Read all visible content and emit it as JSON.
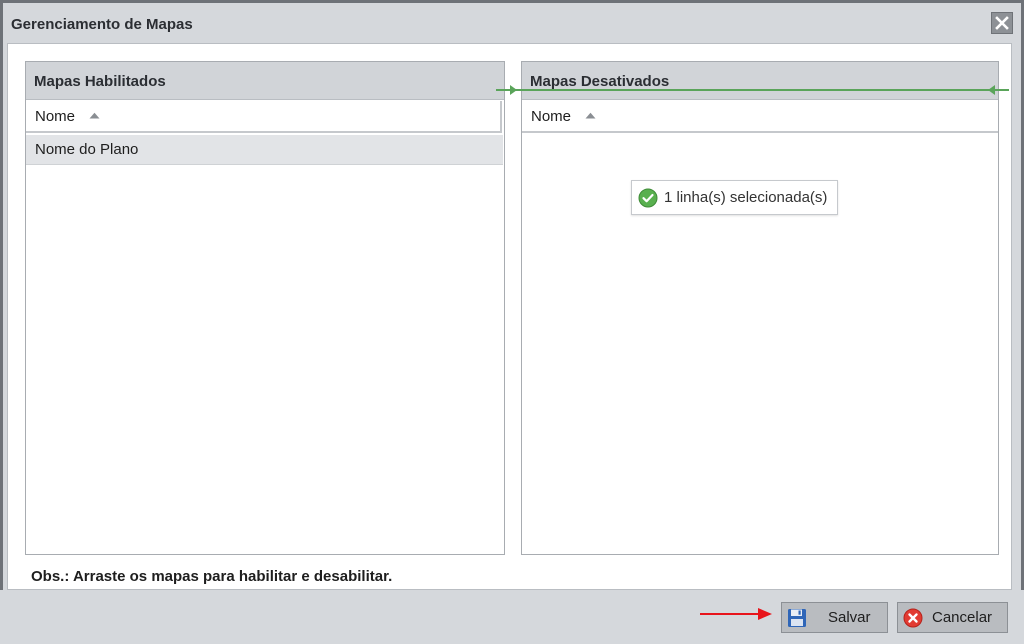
{
  "window": {
    "title": "Gerenciamento de Mapas"
  },
  "left_panel": {
    "title": "Mapas Habilitados",
    "column_header": "Nome",
    "rows": [
      "Nome do Plano"
    ]
  },
  "right_panel": {
    "title": "Mapas Desativados",
    "column_header": "Nome",
    "rows": []
  },
  "drag_tooltip": {
    "text": "1 linha(s) selecionada(s)",
    "icon": "check-circle-icon"
  },
  "note": "Obs.: Arraste os mapas para habilitar e desabilitar.",
  "buttons": {
    "save_label": "Salvar",
    "cancel_label": "Cancelar"
  },
  "colors": {
    "drop_indicator": "#5aa45a",
    "annotation_arrow": "#e8141b",
    "success_icon": "#59b04f",
    "cancel_icon": "#e23b32",
    "save_icon": "#2f66b8"
  }
}
